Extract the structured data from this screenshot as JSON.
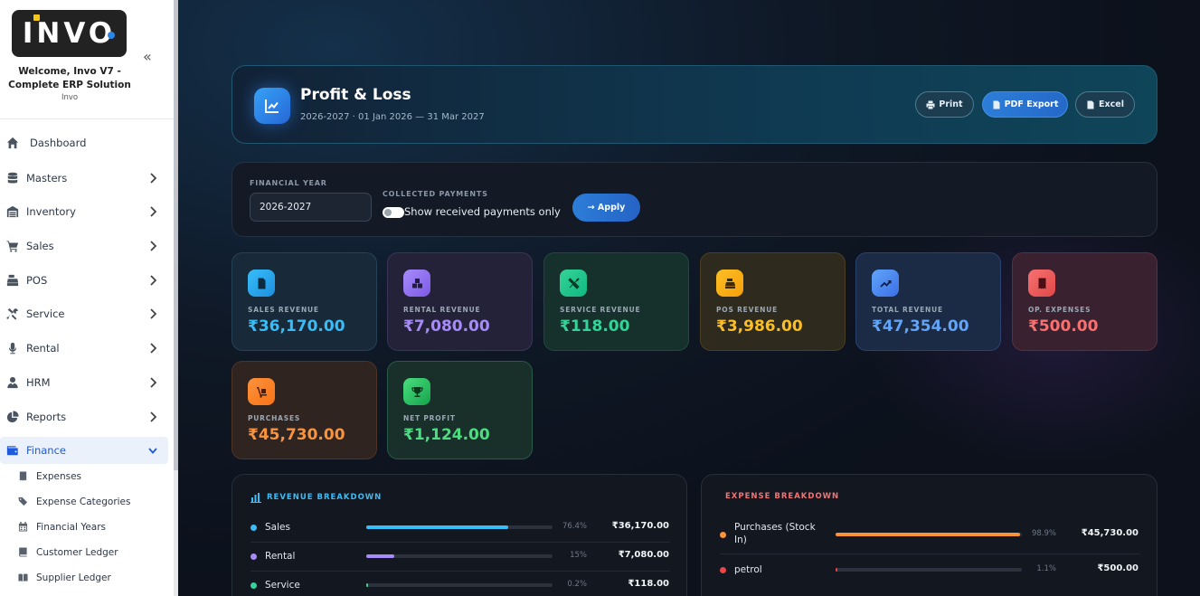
{
  "sidebar": {
    "logo_text": "INVO",
    "welcome": "Welcome, Invo V7 - Complete ERP Solution",
    "company": "Invo",
    "items": [
      {
        "label": "Dashboard",
        "icon": "home-icon"
      },
      {
        "label": "Masters",
        "icon": "database-icon"
      },
      {
        "label": "Inventory",
        "icon": "warehouse-icon"
      },
      {
        "label": "Sales",
        "icon": "cart-icon"
      },
      {
        "label": "POS",
        "icon": "cash-register-icon"
      },
      {
        "label": "Service",
        "icon": "tools-icon"
      },
      {
        "label": "Rental",
        "icon": "microphone-icon"
      },
      {
        "label": "HRM",
        "icon": "user-tie-icon"
      },
      {
        "label": "Reports",
        "icon": "pie-chart-icon"
      },
      {
        "label": "Finance",
        "icon": "wallet-icon",
        "active": true
      }
    ],
    "finance_sub": [
      {
        "label": "Expenses",
        "icon": "receipt-icon"
      },
      {
        "label": "Expense Categories",
        "icon": "tags-icon"
      },
      {
        "label": "Financial Years",
        "icon": "calendar-icon"
      },
      {
        "label": "Customer Ledger",
        "icon": "book-icon"
      },
      {
        "label": "Supplier Ledger",
        "icon": "book-open-icon"
      }
    ]
  },
  "header": {
    "title": "Profit & Loss",
    "subtitle": "2026-2027  ·  01 Jan 2026 — 31 Mar 2027",
    "buttons": {
      "print": "Print",
      "pdf": "PDF Export",
      "excel": "Excel"
    }
  },
  "filters": {
    "fy_label": "FINANCIAL YEAR",
    "fy_value": "2026-2027",
    "collected_label": "COLLECTED PAYMENTS",
    "toggle_label": "Show received payments only",
    "apply_label": "→ Apply"
  },
  "stats": [
    {
      "label": "SALES REVENUE",
      "value": "₹36,170.00",
      "color": "#38bdf8",
      "icon": "file-invoice-icon"
    },
    {
      "label": "RENTAL REVENUE",
      "value": "₹7,080.00",
      "color": "#a78bfa",
      "icon": "boxes-icon"
    },
    {
      "label": "SERVICE REVENUE",
      "value": "₹118.00",
      "color": "#34d399",
      "icon": "tools-icon"
    },
    {
      "label": "POS REVENUE",
      "value": "₹3,986.00",
      "color": "#fbbf24",
      "icon": "cash-register-icon"
    },
    {
      "label": "TOTAL REVENUE",
      "value": "₹47,354.00",
      "color": "#60a5fa",
      "icon": "trend-up-icon"
    },
    {
      "label": "OP. EXPENSES",
      "value": "₹500.00",
      "color": "#f87171",
      "icon": "receipt-icon"
    },
    {
      "label": "PURCHASES",
      "value": "₹45,730.00",
      "color": "#fb923c",
      "icon": "dolly-icon"
    },
    {
      "label": "NET PROFIT",
      "value": "₹1,124.00",
      "color": "#4ade80",
      "icon": "trophy-icon"
    }
  ],
  "revenue": {
    "title": "REVENUE BREAKDOWN",
    "rows": [
      {
        "name": "Sales",
        "pct": "76.4%",
        "frac": 0.764,
        "amount": "₹36,170.00",
        "color": "#38bdf8"
      },
      {
        "name": "Rental",
        "pct": "15%",
        "frac": 0.15,
        "amount": "₹7,080.00",
        "color": "#a78bfa"
      },
      {
        "name": "Service",
        "pct": "0.2%",
        "frac": 0.002,
        "amount": "₹118.00",
        "color": "#34d399"
      }
    ]
  },
  "expense": {
    "title": "EXPENSE BREAKDOWN",
    "rows": [
      {
        "name": "Purchases (Stock In)",
        "pct": "98.9%",
        "frac": 0.989,
        "amount": "₹45,730.00",
        "color": "#fb923c"
      },
      {
        "name": "petrol",
        "pct": "1.1%",
        "frac": 0.011,
        "amount": "₹500.00",
        "color": "#ef4444"
      }
    ]
  }
}
